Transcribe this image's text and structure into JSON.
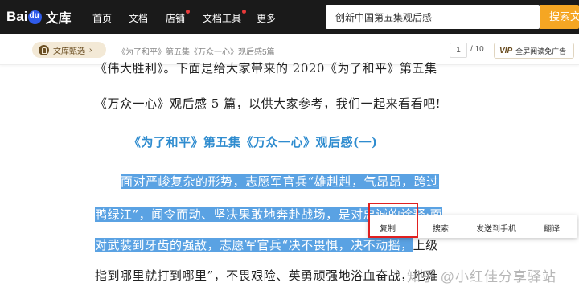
{
  "header": {
    "logo_text": "Bai",
    "logo_suffix": "文库",
    "nav": [
      "首页",
      "文档",
      "店铺",
      "文档工具",
      "更多"
    ],
    "search_value": "创新中国第五集观后感",
    "search_button": "搜索文档"
  },
  "subbar": {
    "pill_label": "文库甄选",
    "doc_title": "《为了和平》第五集《万众一心》观后感5篇",
    "page_current": "1",
    "page_total": "/ 10",
    "vip_icon": "VIP",
    "vip_label": "全屏阅读免广告"
  },
  "document": {
    "line1": "《伟大胜利》。下面是给大家带来的 2020《为了和平》第五集",
    "line2": "《万众一心》观后感 5 篇，以供大家参考，我们一起来看看吧!",
    "heading": "《为了和平》第五集《万众一心》观后感(一)",
    "p1_sel": "面对严峻复杂的形势，志愿军官兵“雄赳赳，气昂昂，跨过",
    "p2_sel": "鸭绿江”，闻令而动、坚决果敢地奔赴战场，",
    "p2_tail": "是对忠诚的诠释;面",
    "p3_sel": "对武装到牙齿的强敌，志愿军官兵“决不畏惧，决不动摇，",
    "p3_tail": "上级",
    "p4": "指到哪里就打到哪里”，不畏艰险、英勇顽强地浴血奋战，",
    "p4_tail": "地难"
  },
  "context_menu": [
    "复制",
    "搜索",
    "发送到手机",
    "翻译"
  ],
  "watermark": "知乎 @小红佳分享驿站",
  "colors": {
    "selection": "#5aa2e3",
    "heading": "#2f8ccf",
    "search_button": "#f5a623"
  }
}
